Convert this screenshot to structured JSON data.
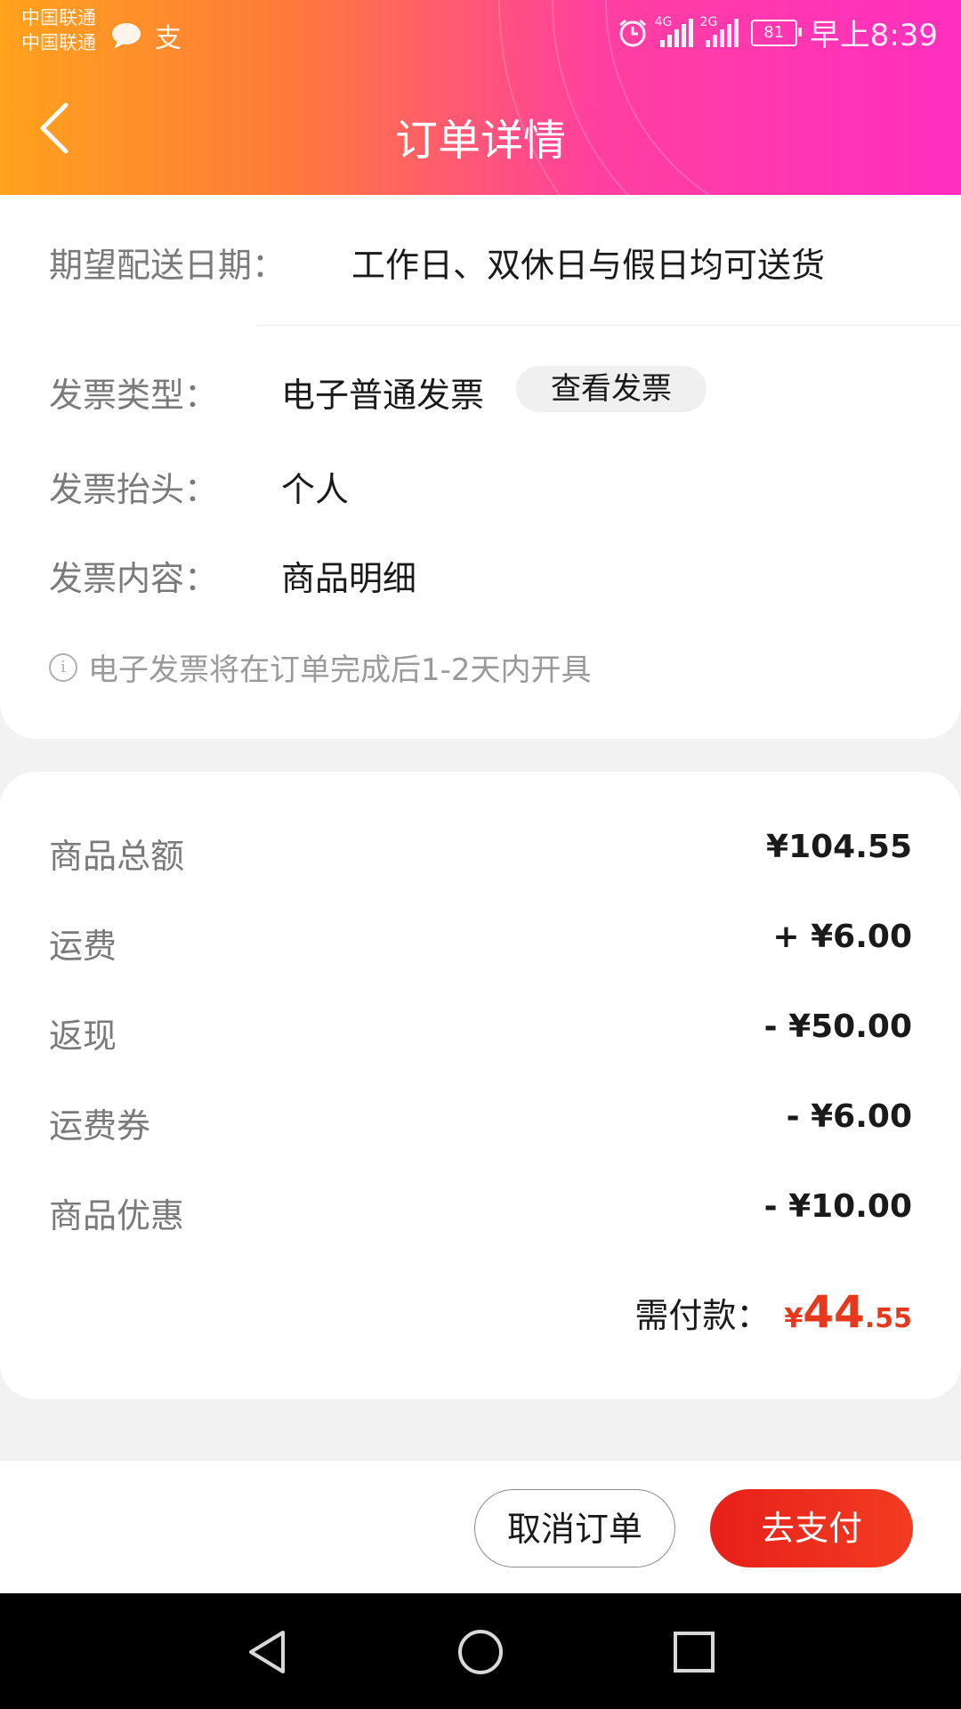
{
  "status_bar": {
    "carrier_1": "中国联通",
    "carrier_2": "中国联通",
    "pay_icon_text": "支",
    "net_1": "4G",
    "net_2": "2G",
    "battery": "81",
    "time": "早上8:39"
  },
  "header": {
    "title": "订单详情",
    "back_icon": "chevron-left-icon"
  },
  "delivery": {
    "label": "期望配送日期：",
    "value": "工作日、双休日与假日均可送货"
  },
  "invoice": {
    "type_label": "发票类型：",
    "type_value": "电子普通发票",
    "view_button": "查看发票",
    "title_label": "发票抬头：",
    "title_value": "个人",
    "content_label": "发票内容：",
    "content_value": "商品明细",
    "note": "电子发票将在订单完成后1-2天内开具"
  },
  "summary": {
    "rows": [
      {
        "label": "商品总额",
        "value": "¥104.55"
      },
      {
        "label": "运费",
        "value": "+ ¥6.00"
      },
      {
        "label": "返现",
        "value": "- ¥50.00"
      },
      {
        "label": "运费券",
        "value": "- ¥6.00"
      },
      {
        "label": "商品优惠",
        "value": "- ¥10.00"
      }
    ],
    "total_label": "需付款：",
    "total_currency": "¥",
    "total_int": "44",
    "total_dec": ".55"
  },
  "actions": {
    "cancel": "取消订单",
    "pay": "去支付"
  },
  "colors": {
    "accent": "#e8381c",
    "header_start": "#ffa21c",
    "header_end": "#ff2fc0"
  }
}
